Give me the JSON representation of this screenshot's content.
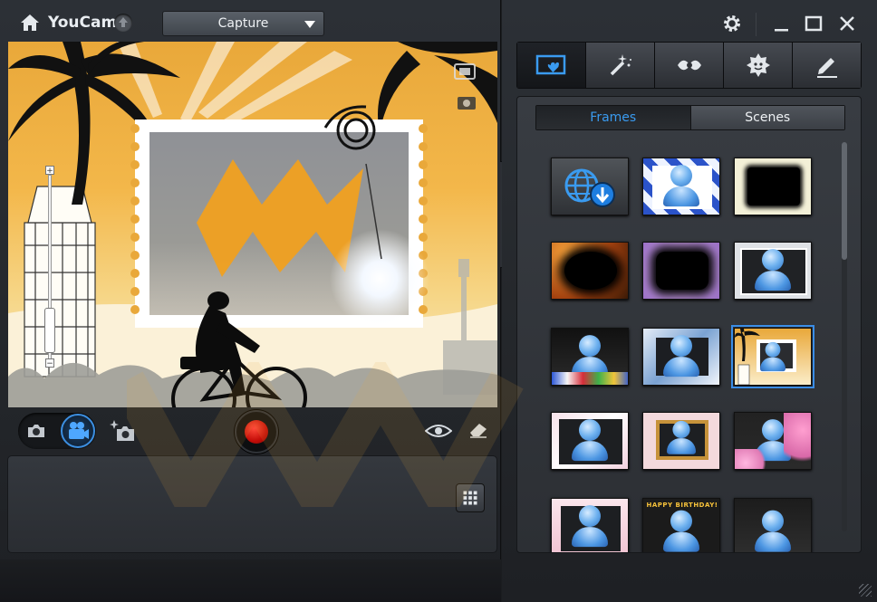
{
  "app": {
    "title": "YouCam",
    "mode_select": "Capture"
  },
  "content": {
    "tabs": [
      {
        "label": "Frames",
        "active": true
      },
      {
        "label": "Scenes",
        "active": false
      }
    ]
  },
  "toolbar": {
    "tabs": [
      {
        "name": "frames-scenes",
        "icon": "screen-heart-icon",
        "active": true
      },
      {
        "name": "effects",
        "icon": "magic-wand-icon",
        "active": false
      },
      {
        "name": "particles",
        "icon": "sparkle-icon",
        "active": false
      },
      {
        "name": "avatars",
        "icon": "face-icon",
        "active": false
      },
      {
        "name": "drawing",
        "icon": "pencil-icon",
        "active": false
      }
    ]
  },
  "frames": {
    "selected_index": 8,
    "items": [
      {
        "name": "download-more"
      },
      {
        "name": "blue-checker"
      },
      {
        "name": "ink-splash"
      },
      {
        "name": "orange-bokeh"
      },
      {
        "name": "purple-sparkle"
      },
      {
        "name": "photo-collage"
      },
      {
        "name": "party-gifts"
      },
      {
        "name": "blue-floral"
      },
      {
        "name": "travel-postcard"
      },
      {
        "name": "pink-lace"
      },
      {
        "name": "gold-picture-frame"
      },
      {
        "name": "pink-blossoms"
      },
      {
        "name": "pink-petals"
      },
      {
        "name": "happy-birthday",
        "text": "HAPPY BIRTHDAY!"
      },
      {
        "name": "dark-plain"
      }
    ]
  },
  "colors": {
    "accent": "#3a9bf0",
    "record": "#d2140e",
    "panel": "#2c3036"
  }
}
